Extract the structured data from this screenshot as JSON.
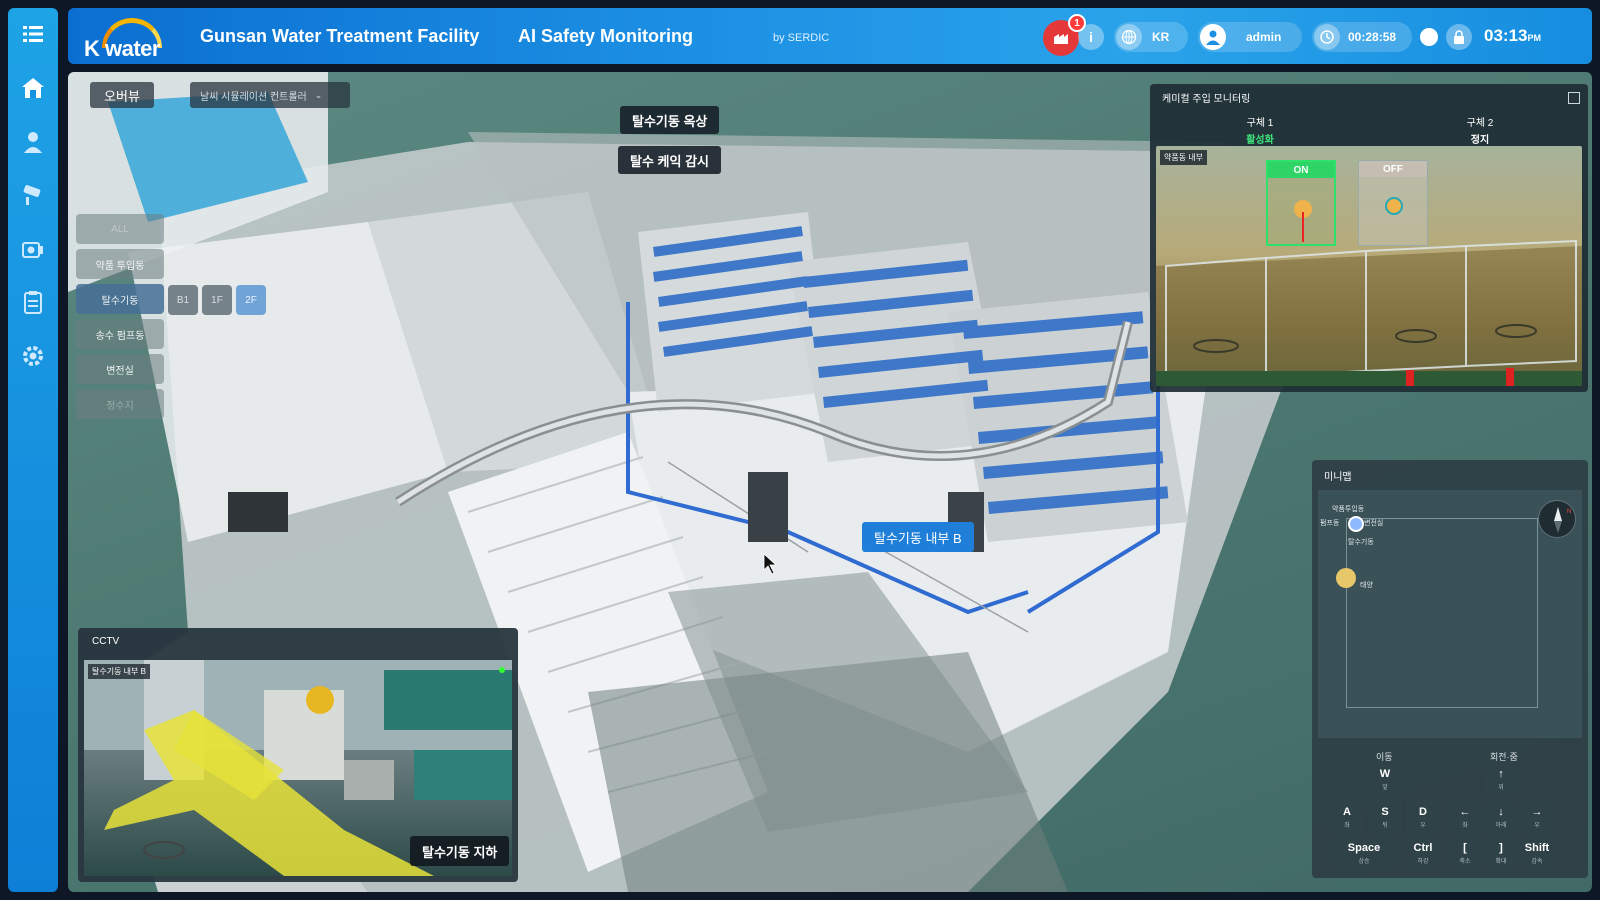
{
  "header": {
    "logo_text": "K water",
    "title": "Gunsan Water Treatment Facility",
    "subtitle": "AI Safety Monitoring",
    "by": "by SERDIC",
    "alarm_count": "1",
    "language": "KR",
    "user": "admin",
    "timer": "00:28:58",
    "time": "03:13",
    "time_suffix": "PM"
  },
  "sidebar": {
    "icons": [
      "menu-icon",
      "home-icon",
      "worker-icon",
      "cctv-camera-icon",
      "camera-device-icon",
      "clipboard-icon",
      "settings-icon"
    ]
  },
  "toolbar": {
    "overview_tab": "오버뷰",
    "dropdown_label": "날씨 시뮬레이션 컨트롤러"
  },
  "floor_menu": {
    "items": [
      "ALL",
      "약품 투입동",
      "탈수기동",
      "송수 펌프동",
      "변전실",
      "정수지"
    ],
    "active": "탈수기동",
    "floors": [
      "B1",
      "1F",
      "2F"
    ],
    "selected_floor": "2F"
  },
  "scene_labels": {
    "roof": "탈수기동 옥상",
    "cake": "탈수 케익 감시",
    "inside_b": "탈수기동 내부 B"
  },
  "chem_panel": {
    "title": "케미컬 주입 모니터링",
    "unit1": "구체 1",
    "unit1_status": "활성화",
    "unit2": "구체 2",
    "unit2_status": "정지",
    "view_tag": "약품동 내부",
    "on_label": "ON",
    "off_label": "OFF"
  },
  "minimap": {
    "title": "미니맵",
    "labels": [
      "약품투입동",
      "펌프동",
      "변전실",
      "탈수기동",
      "태양"
    ],
    "move_header": "이동",
    "rotate_header": "회전·줌",
    "keys": [
      {
        "k": "W",
        "s": "앞"
      },
      {
        "k": "A",
        "s": "좌"
      },
      {
        "k": "S",
        "s": "뒤"
      },
      {
        "k": "D",
        "s": "우"
      },
      {
        "k": "Space",
        "s": "상승"
      },
      {
        "k": "Ctrl",
        "s": "하강"
      },
      {
        "k": "↑",
        "s": "위"
      },
      {
        "k": "←",
        "s": "좌"
      },
      {
        "k": "↓",
        "s": "아래"
      },
      {
        "k": "→",
        "s": "우"
      },
      {
        "k": "[",
        "s": "축소"
      },
      {
        "k": "]",
        "s": "확대"
      },
      {
        "k": "Shift",
        "s": "감속"
      }
    ]
  },
  "cctv": {
    "title": "CCTV",
    "tag": "탈수기동 내부 B",
    "label": "탈수기동 지하"
  },
  "colors": {
    "header_blue": "#1c8fe3",
    "rail_blue": "#1ea3e6",
    "alarm_red": "#e53838",
    "on_green": "#2fd466",
    "highlight_yellow": "#e6e23a"
  }
}
